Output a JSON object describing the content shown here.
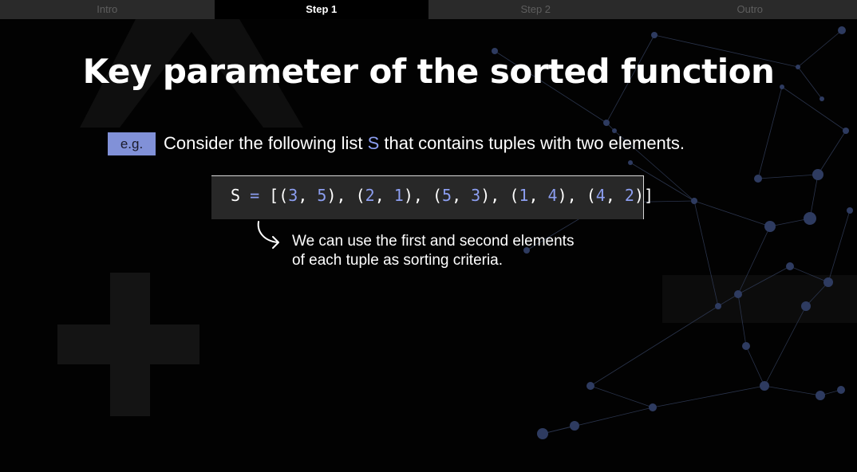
{
  "nav": {
    "tabs": [
      {
        "label": "Intro",
        "active": false
      },
      {
        "label": "Step 1",
        "active": true
      },
      {
        "label": "Step 2",
        "active": false
      },
      {
        "label": "Outro",
        "active": false
      }
    ]
  },
  "slide": {
    "title": "Key parameter of the sorted function",
    "example_badge": "e.g.",
    "example_prefix": "Consider the following list ",
    "example_list_name": "S",
    "example_suffix": " that contains tuples with two elements.",
    "code": {
      "var": "S",
      "op": "=",
      "tuples": [
        [
          3,
          5
        ],
        [
          2,
          1
        ],
        [
          5,
          3
        ],
        [
          1,
          4
        ],
        [
          4,
          2
        ]
      ]
    },
    "note": {
      "line1": "We can use the first and second elements",
      "line2": "of each tuple as sorting criteria."
    }
  },
  "colors": {
    "accent": "#8c9ef0",
    "badge_bg": "#8191d8",
    "code_bg": "#282828",
    "tab_bg": "#2a2a2a"
  },
  "icons": {
    "arrow": "curved-arrow-icon"
  }
}
